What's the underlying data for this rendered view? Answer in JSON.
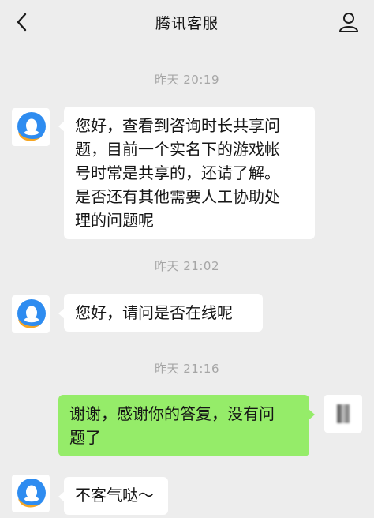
{
  "header": {
    "title": "腾讯客服",
    "back_icon": "chevron-left-icon",
    "profile_icon": "person-icon"
  },
  "messages": [
    {
      "type": "timestamp",
      "text": "昨天 20:19"
    },
    {
      "type": "incoming",
      "avatar_icon": "tencent-qq-penguin-icon",
      "text": "您好，查看到咨询时长共享问\n题，目前一个实名下的游戏帐\n号时常是共享的，还请了解。\n是否还有其他需要人工协助处\n理的问题呢"
    },
    {
      "type": "timestamp",
      "text": "昨天 21:02"
    },
    {
      "type": "incoming",
      "avatar_icon": "tencent-qq-penguin-icon",
      "text": "您好，请问是否在线呢"
    },
    {
      "type": "timestamp",
      "text": "昨天 21:16"
    },
    {
      "type": "outgoing",
      "avatar_icon": "blurred-user-avatar",
      "text": "谢谢，感谢你的答复，没有问\n题了"
    },
    {
      "type": "incoming",
      "avatar_icon": "tencent-qq-penguin-icon",
      "text": "不客气哒～"
    }
  ],
  "colors": {
    "background": "#ededed",
    "incoming_bubble": "#ffffff",
    "outgoing_bubble": "#95ec69",
    "timestamp_text": "#a6a6a6",
    "avatar_blue": "#2e8cf0",
    "avatar_orange": "#f6a623"
  }
}
